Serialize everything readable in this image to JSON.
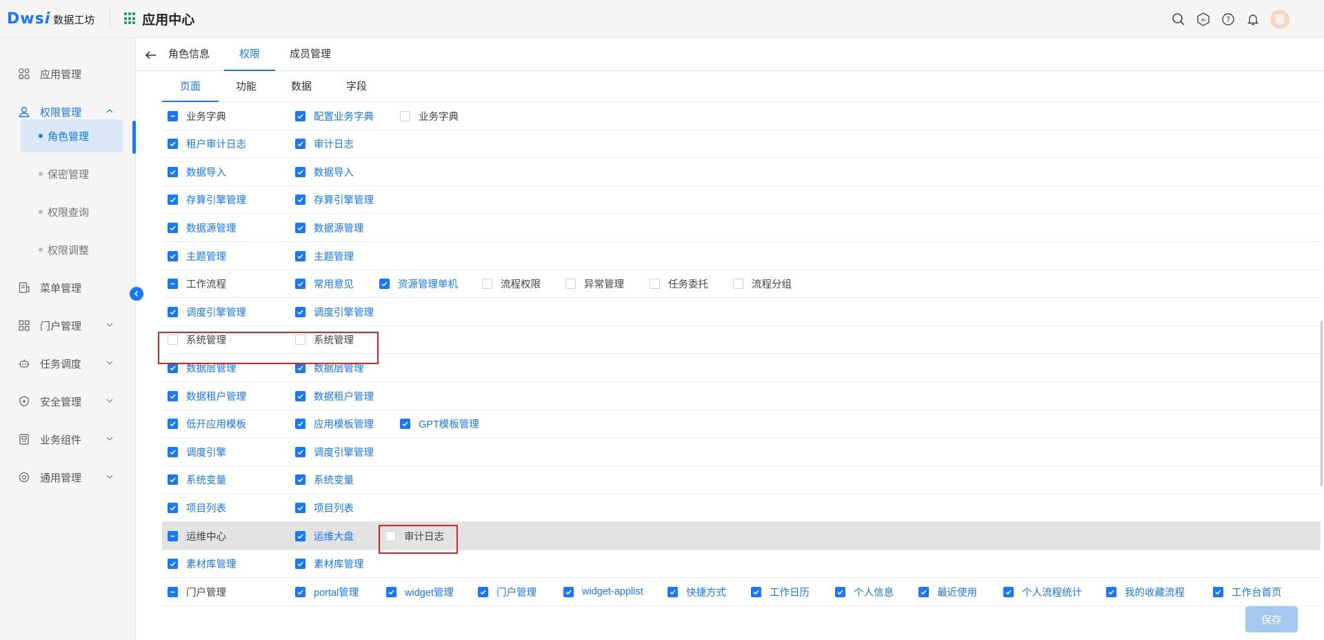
{
  "header": {
    "logo_mark": "Dws",
    "logo_mark_i": "i",
    "logo_text": "数据工坊",
    "app_title": "应用中心",
    "avatar_text": "租",
    "icons": [
      "search-icon",
      "ai-icon",
      "help-icon",
      "bell-icon"
    ]
  },
  "sidebar": {
    "items": [
      {
        "label": "应用管理",
        "icon": "apps-icon"
      },
      {
        "label": "权限管理",
        "icon": "user-permission-icon"
      },
      {
        "label": "菜单管理",
        "icon": "menu-doc-icon"
      },
      {
        "label": "门户管理",
        "icon": "portal-icon"
      },
      {
        "label": "任务调度",
        "icon": "robot-icon"
      },
      {
        "label": "安全管理",
        "icon": "shield-icon"
      },
      {
        "label": "业务组件",
        "icon": "component-icon"
      },
      {
        "label": "通用管理",
        "icon": "gear-icon"
      }
    ],
    "sub_items": [
      {
        "label": "角色管理"
      },
      {
        "label": "保密管理"
      },
      {
        "label": "权限查询"
      },
      {
        "label": "权限调整"
      }
    ]
  },
  "tabs_primary": [
    {
      "label": "角色信息"
    },
    {
      "label": "权限"
    },
    {
      "label": "成员管理"
    }
  ],
  "tabs_secondary": [
    {
      "label": "页面"
    },
    {
      "label": "功能"
    },
    {
      "label": "数据"
    },
    {
      "label": "字段"
    }
  ],
  "permission_rows": [
    {
      "parent": {
        "label": "业务字典",
        "state": "partial"
      },
      "children": [
        {
          "label": "配置业务字典",
          "state": "checked"
        },
        {
          "label": "业务字典",
          "state": "unchecked"
        }
      ]
    },
    {
      "parent": {
        "label": "租户审计日志",
        "state": "checked"
      },
      "children": [
        {
          "label": "审计日志",
          "state": "checked"
        }
      ]
    },
    {
      "parent": {
        "label": "数据导入",
        "state": "checked"
      },
      "children": [
        {
          "label": "数据导入",
          "state": "checked"
        }
      ]
    },
    {
      "parent": {
        "label": "存算引擎管理",
        "state": "checked"
      },
      "children": [
        {
          "label": "存算引擎管理",
          "state": "checked"
        }
      ]
    },
    {
      "parent": {
        "label": "数据源管理",
        "state": "checked"
      },
      "children": [
        {
          "label": "数据源管理",
          "state": "checked"
        }
      ]
    },
    {
      "parent": {
        "label": "主题管理",
        "state": "checked"
      },
      "children": [
        {
          "label": "主题管理",
          "state": "checked"
        }
      ]
    },
    {
      "parent": {
        "label": "工作流程",
        "state": "partial"
      },
      "children": [
        {
          "label": "常用意见",
          "state": "checked"
        },
        {
          "label": "资源管理单机",
          "state": "checked"
        },
        {
          "label": "流程权限",
          "state": "unchecked"
        },
        {
          "label": "异常管理",
          "state": "unchecked"
        },
        {
          "label": "任务委托",
          "state": "unchecked"
        },
        {
          "label": "流程分组",
          "state": "unchecked"
        }
      ]
    },
    {
      "parent": {
        "label": "调度引擎管理",
        "state": "checked"
      },
      "children": [
        {
          "label": "调度引擎管理",
          "state": "checked"
        }
      ]
    },
    {
      "parent": {
        "label": "系统管理",
        "state": "unchecked"
      },
      "children": [
        {
          "label": "系统管理",
          "state": "unchecked"
        }
      ]
    },
    {
      "parent": {
        "label": "数据层管理",
        "state": "checked"
      },
      "children": [
        {
          "label": "数据层管理",
          "state": "checked"
        }
      ]
    },
    {
      "parent": {
        "label": "数据租户管理",
        "state": "checked"
      },
      "children": [
        {
          "label": "数据租户管理",
          "state": "checked"
        }
      ]
    },
    {
      "parent": {
        "label": "低开应用模板",
        "state": "checked"
      },
      "children": [
        {
          "label": "应用模板管理",
          "state": "checked"
        },
        {
          "label": "GPT模板管理",
          "state": "checked"
        }
      ]
    },
    {
      "parent": {
        "label": "调度引擎",
        "state": "checked"
      },
      "children": [
        {
          "label": "调度引擎管理",
          "state": "checked"
        }
      ]
    },
    {
      "parent": {
        "label": "系统变量",
        "state": "checked"
      },
      "children": [
        {
          "label": "系统变量",
          "state": "checked"
        }
      ]
    },
    {
      "parent": {
        "label": "项目列表",
        "state": "checked"
      },
      "children": [
        {
          "label": "项目列表",
          "state": "checked"
        }
      ]
    },
    {
      "parent": {
        "label": "运维中心",
        "state": "partial"
      },
      "children": [
        {
          "label": "运维大盘",
          "state": "checked"
        },
        {
          "label": "审计日志",
          "state": "unchecked"
        }
      ]
    },
    {
      "parent": {
        "label": "素材库管理",
        "state": "checked"
      },
      "children": [
        {
          "label": "素材库管理",
          "state": "checked"
        }
      ]
    },
    {
      "parent": {
        "label": "门户管理",
        "state": "partial"
      },
      "children": [
        {
          "label": "portal管理",
          "state": "checked"
        },
        {
          "label": "widget管理",
          "state": "checked"
        },
        {
          "label": "门户管理",
          "state": "checked"
        },
        {
          "label": "widget-applist",
          "state": "checked"
        },
        {
          "label": "快捷方式",
          "state": "checked"
        },
        {
          "label": "工作日历",
          "state": "checked"
        },
        {
          "label": "个人信息",
          "state": "checked"
        },
        {
          "label": "最近使用",
          "state": "checked"
        },
        {
          "label": "个人流程统计",
          "state": "checked"
        },
        {
          "label": "我的收藏流程",
          "state": "checked"
        },
        {
          "label": "工作台首页",
          "state": "checked"
        }
      ]
    }
  ],
  "save_label": "保存",
  "colors": {
    "accent": "#1677ff",
    "highlight_box": "#e02020",
    "save_disabled": "#a5c8f0"
  }
}
